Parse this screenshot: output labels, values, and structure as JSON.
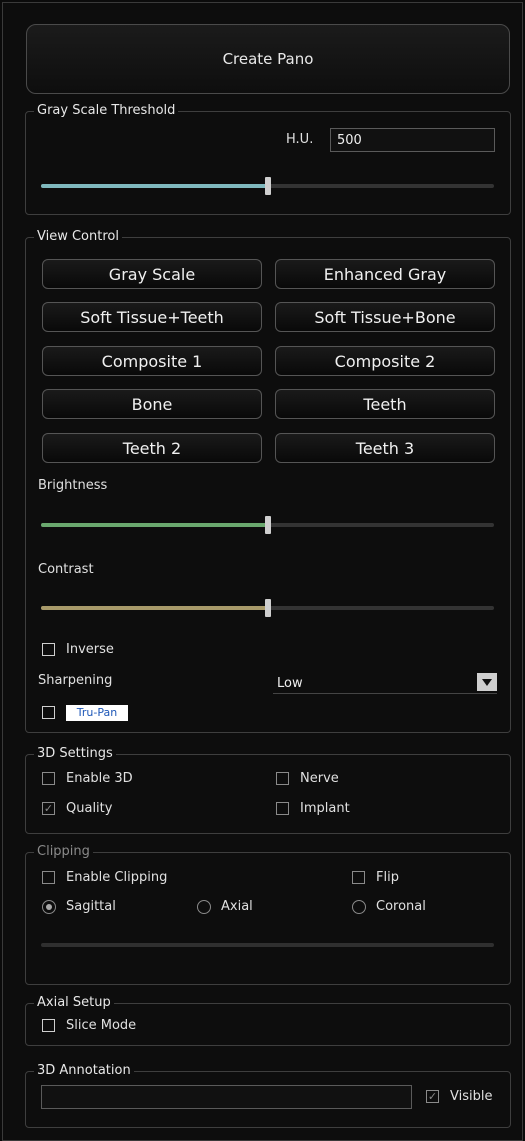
{
  "create_pano": "Create Pano",
  "gray_scale_threshold": {
    "title": "Gray Scale Threshold",
    "hu_label": "H.U.",
    "hu_value": "500",
    "slider_fraction": 0.5,
    "color": "#7fb8bd"
  },
  "view_control": {
    "title": "View Control",
    "buttons": [
      "Gray Scale",
      "Enhanced Gray",
      "Soft Tissue+Teeth",
      "Soft Tissue+Bone",
      "Composite 1",
      "Composite 2",
      "Bone",
      "Teeth",
      "Teeth 2",
      "Teeth 3"
    ],
    "brightness_label": "Brightness",
    "brightness_fraction": 0.5,
    "brightness_color": "#6aa86e",
    "contrast_label": "Contrast",
    "contrast_fraction": 0.5,
    "contrast_color": "#a89a6a",
    "inverse_label": "Inverse",
    "sharpening_label": "Sharpening",
    "sharpening_value": "Low",
    "trupan_logo_text": "Tru-Pan"
  },
  "settings_3d": {
    "title": "3D Settings",
    "enable_3d": "Enable 3D",
    "nerve": "Nerve",
    "quality": "Quality",
    "quality_checked": true,
    "implant": "Implant"
  },
  "clipping": {
    "title": "Clipping",
    "enable_clipping": "Enable Clipping",
    "flip": "Flip",
    "sagittal": "Sagittal",
    "axial": "Axial",
    "coronal": "Coronal",
    "selected": "Sagittal"
  },
  "axial_setup": {
    "title": "Axial Setup",
    "slice_mode": "Slice Mode"
  },
  "annotation_3d": {
    "title": "3D Annotation",
    "text_value": "",
    "visible_label": "Visible",
    "visible_checked": true
  }
}
